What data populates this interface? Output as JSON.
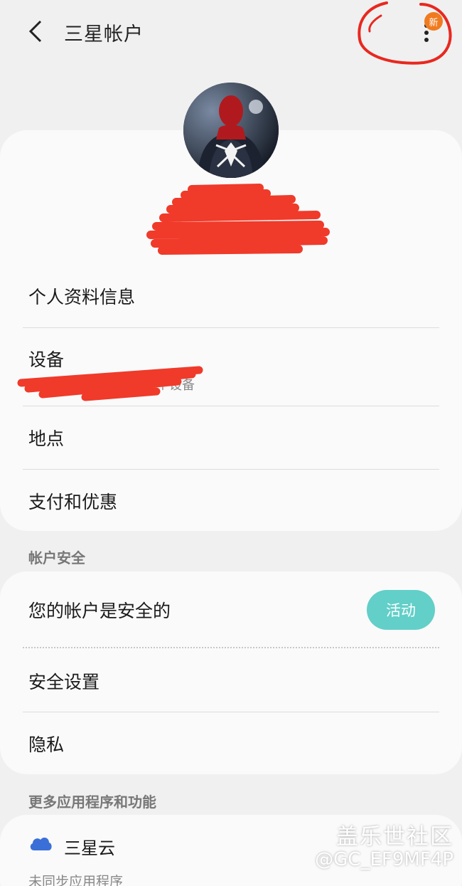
{
  "header": {
    "title": "三星帐户",
    "new_badge": "新"
  },
  "profile": {
    "name": ""
  },
  "profile_section": {
    "items": [
      {
        "label": "个人资料信息"
      },
      {
        "label": "设备",
        "sub": "个设备"
      },
      {
        "label": "地点"
      },
      {
        "label": "支付和优惠"
      }
    ]
  },
  "security_section": {
    "header": "帐户安全",
    "status_label": "您的帐户是安全的",
    "status_button": "活动",
    "items": [
      {
        "label": "安全设置"
      },
      {
        "label": "隐私"
      }
    ]
  },
  "more_section": {
    "header": "更多应用程序和功能",
    "cloud_label": "三星云",
    "cloud_sub": "未同步应用程序"
  },
  "watermark": {
    "line1": "盖乐世社区",
    "line2": "@GC_EF9MF4P"
  },
  "colors": {
    "accent_teal": "#62cfc8",
    "badge_orange": "#f07b1f",
    "cloud_blue": "#3b6fd8",
    "redaction_red": "#f03a2a"
  }
}
